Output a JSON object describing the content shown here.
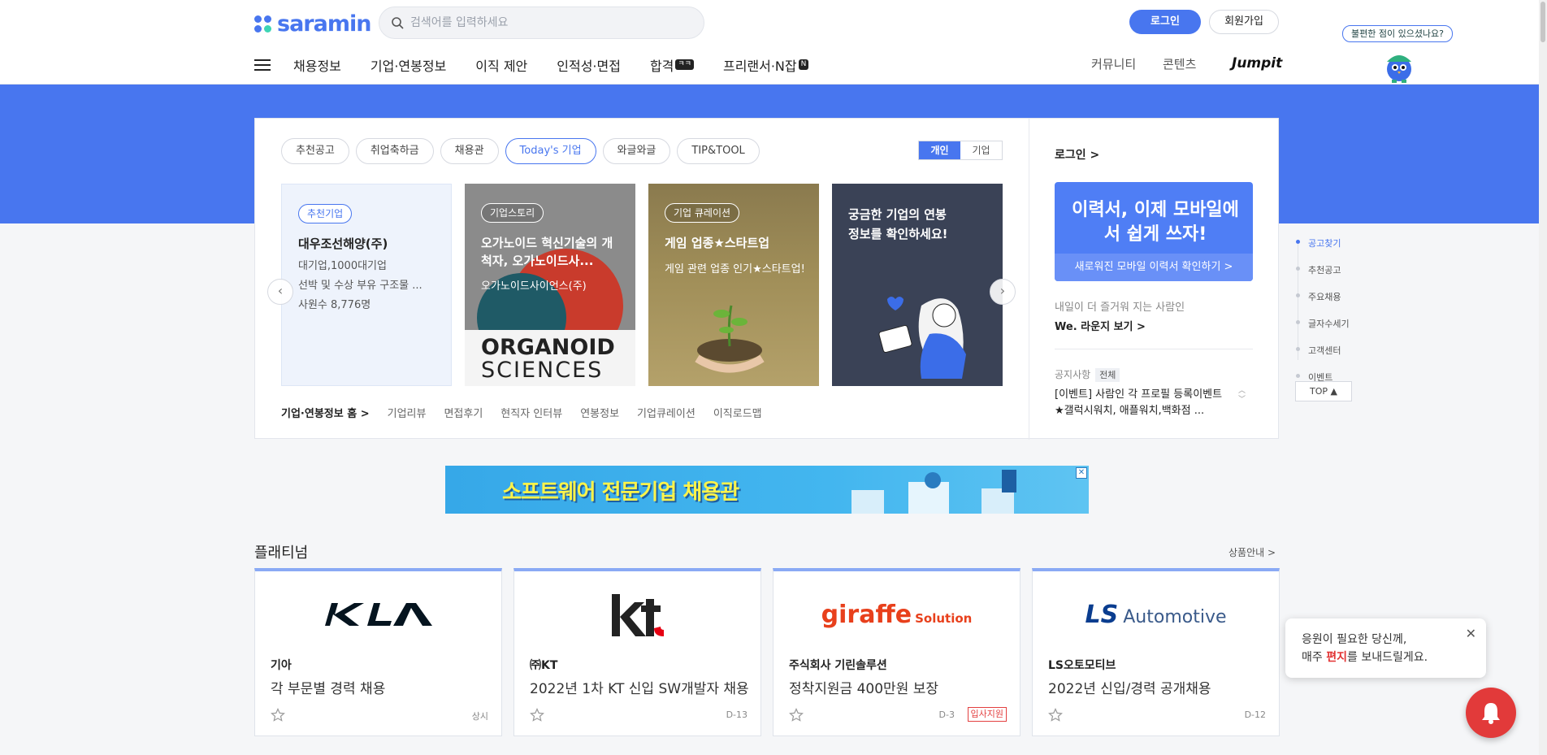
{
  "header": {
    "logo_text": "saramin",
    "search_placeholder": "검색어를 입력하세요",
    "login_label": "로그인",
    "join_label": "회원가입",
    "mascot_bubble": "불편한 점이 있으셨나요?",
    "nav_items": [
      {
        "label": "채용정보",
        "badge": ""
      },
      {
        "label": "기업·연봉정보",
        "badge": ""
      },
      {
        "label": "이직 제안",
        "badge": ""
      },
      {
        "label": "인적성·면접",
        "badge": ""
      },
      {
        "label": "합격",
        "badge": "ㅋㅋ"
      },
      {
        "label": "프리랜서·N잡",
        "badge": "N"
      }
    ],
    "nav_right": [
      "커뮤니티",
      "콘텐츠"
    ],
    "jumpit": "Jumpit"
  },
  "main": {
    "tabs": [
      "추천공고",
      "취업축하금",
      "채용관",
      "Today's 기업",
      "와글와글",
      "TIP&TOOL"
    ],
    "active_tab": "Today's 기업",
    "toggle": [
      "개인",
      "기업"
    ],
    "cards": [
      {
        "tag": "추천기업",
        "title": "대우조선해양(주)",
        "lines": [
          "대기업,1000대기업",
          "선박 및 수상 부유 구조물 ...",
          "사원수 8,776명"
        ]
      },
      {
        "tag": "기업스토리",
        "title": "오가노이드 혁신기술의 개척자, 오가노이드사...",
        "lines": [
          "오가노이드사이언스(주)"
        ],
        "brand1": "ORGANOID",
        "brand2": "SCIENCES"
      },
      {
        "tag": "기업 큐레이션",
        "title": "게임 업종★스타트업",
        "lines": [
          "게임 관련 업종 인기★스타트업!"
        ]
      },
      {
        "tag": "",
        "title": "궁금한 기업의 연봉정보를 확인하세요!",
        "lines": []
      }
    ],
    "links": [
      "기업·연봉정보 홈 >",
      "기업리뷰",
      "면접후기",
      "현직자 인터뷰",
      "연봉정보",
      "기업큐레이션",
      "이직로드맵"
    ]
  },
  "right_panel": {
    "login": "로그인 >",
    "banner_big": "이력서, 이제 모바일에서 쉽게 쓰자!",
    "banner_small": "새로워진 모바일 이력서 확인하기 >",
    "we_sub": "내일이 더 즐거워 지는 사람인",
    "we_link": "We. 라운지 보기 >",
    "notice_label": "공지사항",
    "notice_all": "전체",
    "notice_text": "[이벤트] 사람인 각 프로필 등록이벤트 ★갤럭시워치, 애플워치,백화점 ..."
  },
  "quick_nav": [
    "공고찾기",
    "추천공고",
    "주요채용",
    "글자수세기",
    "고객센터",
    "이벤트"
  ],
  "top_label": "TOP ▲",
  "sw_ad": {
    "text": "소프트웨어 전문기업 채용관",
    "close": "✕"
  },
  "platinum": {
    "title": "플래티넘",
    "guide": "상품안내 >",
    "cards": [
      {
        "logo": "KIA",
        "company": "기아",
        "title": "각 부문별 경력 채용",
        "dday": "상시",
        "tag": ""
      },
      {
        "logo": "kt",
        "company": "㈜KT",
        "title": "2022년 1차 KT 신입 SW개발자 채용",
        "dday": "D-13",
        "tag": ""
      },
      {
        "logo": "giraffe Solution",
        "company": "주식회사 기린솔루션",
        "title": "정착지원금 400만원 보장",
        "dday": "D-3",
        "tag": "입사지원"
      },
      {
        "logo": "LS Automotive",
        "company": "LS오토모티브",
        "title": "2022년 신입/경력 공개채용",
        "dday": "D-12",
        "tag": ""
      }
    ]
  },
  "popup": {
    "line1": "응원이 필요한 당신께,",
    "line2a": "매주 ",
    "line2b": "편지",
    "line2c": "를 보내드릴게요."
  }
}
